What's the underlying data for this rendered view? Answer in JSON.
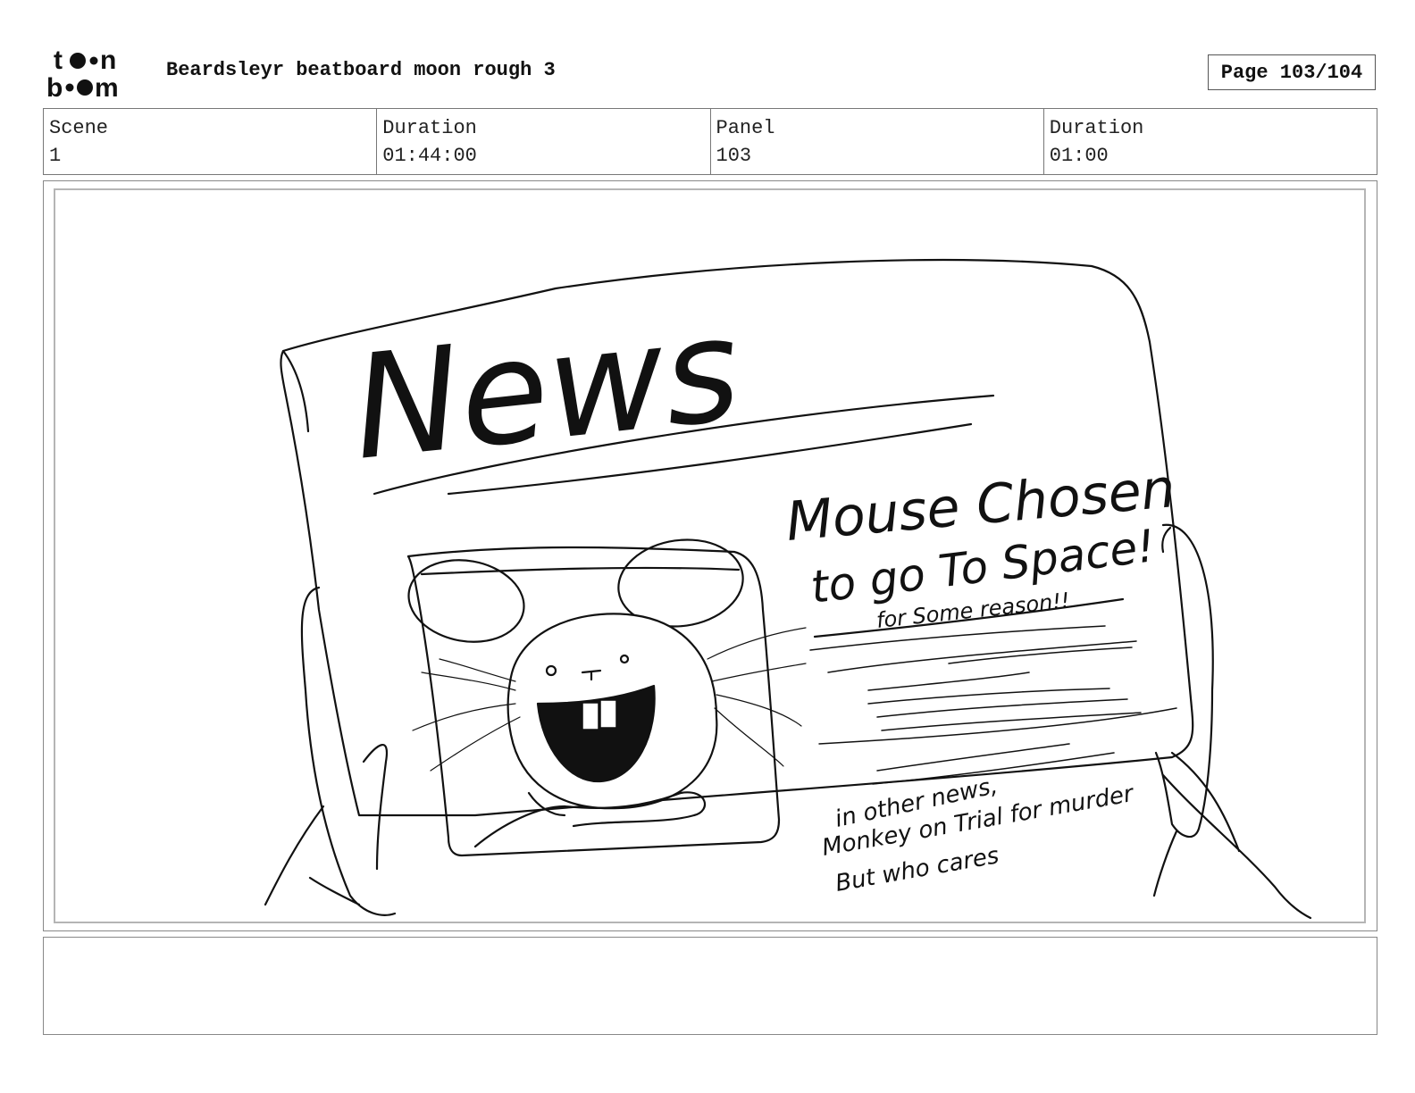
{
  "header": {
    "logo_text": "toonboom",
    "project_title": "Beardsleyr beatboard moon rough 3",
    "page_label": "Page 103/104"
  },
  "info": {
    "scene_label": "Scene",
    "scene_value": "1",
    "duration_label": "Duration",
    "duration_value": "01:44:00",
    "panel_label": "Panel",
    "panel_value": "103",
    "panel_duration_label": "Duration",
    "panel_duration_value": "01:00"
  },
  "sketch": {
    "masthead": "News",
    "headline_line1": "Mouse Chosen",
    "headline_line2": "to go To Space!",
    "subheadline": "for Some reason!!",
    "other_news_line1": "in other news,",
    "other_news_line2": "Monkey on Trial for murder",
    "other_news_line3": "But who cares"
  },
  "notes": {
    "text": ""
  }
}
